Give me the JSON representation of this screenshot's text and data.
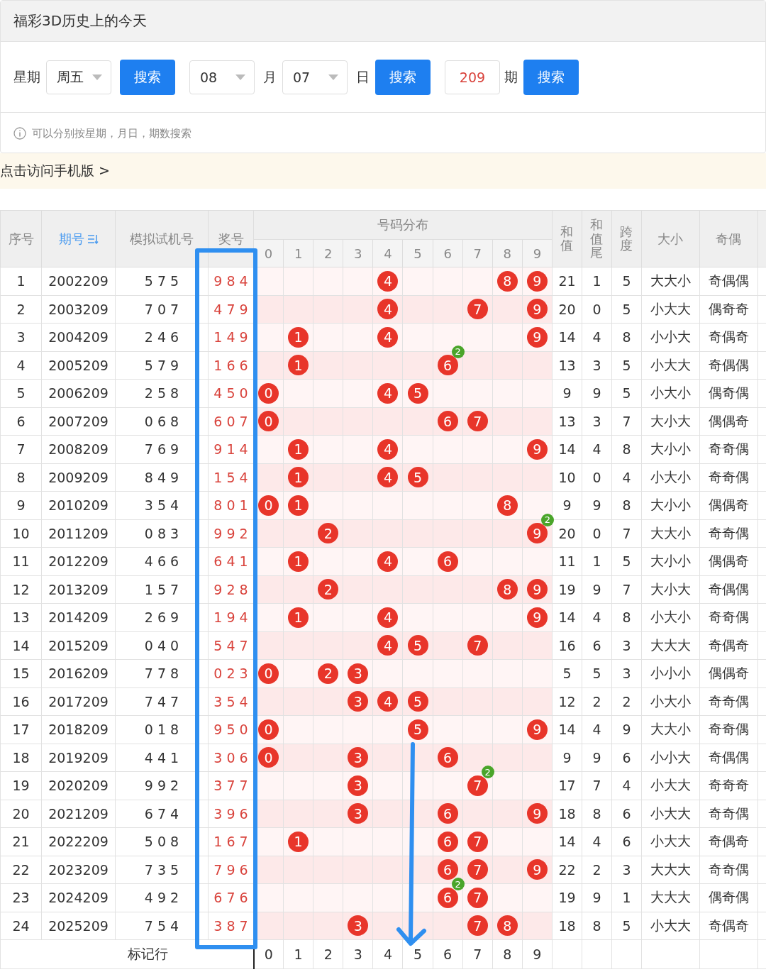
{
  "panel": {
    "title": "福彩3D历史上的今天",
    "controls": [
      {
        "kind": "label",
        "text": "星期"
      },
      {
        "kind": "select",
        "value": "周五"
      },
      {
        "kind": "button",
        "text": "搜索"
      },
      {
        "kind": "select",
        "value": "08"
      },
      {
        "kind": "label",
        "text": "月"
      },
      {
        "kind": "select",
        "value": "07"
      },
      {
        "kind": "label",
        "text": "日"
      },
      {
        "kind": "button",
        "text": "搜索"
      },
      {
        "kind": "input",
        "value": "209"
      },
      {
        "kind": "label",
        "text": "期"
      },
      {
        "kind": "button",
        "text": "搜索"
      }
    ],
    "hint": "可以分别按星期，月日，期数搜索"
  },
  "mobile_link": "点击访问手机版 >",
  "table": {
    "lead_columns": [
      {
        "label": "序号",
        "sortable": false
      },
      {
        "label": "期号",
        "sortable": true
      },
      {
        "label": "模拟试机号",
        "sortable": false
      },
      {
        "label": "奖号",
        "sortable": false
      }
    ],
    "distribution_header": {
      "label": "号码分布",
      "digits": [
        "0",
        "1",
        "2",
        "3",
        "4",
        "5",
        "6",
        "7",
        "8",
        "9"
      ]
    },
    "tail_columns": [
      {
        "label": "和值",
        "stacked": true
      },
      {
        "label": "和值尾",
        "stacked": true
      },
      {
        "label": "跨度",
        "stacked": true
      },
      {
        "label": "大小",
        "stacked": false
      },
      {
        "label": "奇偶",
        "stacked": false
      }
    ],
    "rows": [
      {
        "seq": "1",
        "period": "2002209",
        "trial": "5 7 5",
        "draw": "9 8 4",
        "distribution": [
          {
            "hit": false
          },
          {
            "hit": false
          },
          {
            "hit": false
          },
          {
            "hit": false
          },
          {
            "hit": true,
            "ball": "4"
          },
          {
            "hit": false
          },
          {
            "hit": false
          },
          {
            "hit": false
          },
          {
            "hit": true,
            "ball": "8"
          },
          {
            "hit": true,
            "ball": "9"
          }
        ],
        "sum": "21",
        "sum_tail": "1",
        "span": "5",
        "size": "大大小",
        "parity": "奇偶偶"
      },
      {
        "seq": "2",
        "period": "2003209",
        "trial": "7 0 7",
        "draw": "4 7 9",
        "distribution": [
          {
            "hit": false
          },
          {
            "hit": false
          },
          {
            "hit": false
          },
          {
            "hit": false
          },
          {
            "hit": true,
            "ball": "4"
          },
          {
            "hit": false
          },
          {
            "hit": false
          },
          {
            "hit": true,
            "ball": "7"
          },
          {
            "hit": false
          },
          {
            "hit": true,
            "ball": "9"
          }
        ],
        "sum": "20",
        "sum_tail": "0",
        "span": "5",
        "size": "小大大",
        "parity": "偶奇奇"
      },
      {
        "seq": "3",
        "period": "2004209",
        "trial": "2 4 6",
        "draw": "1 4 9",
        "distribution": [
          {
            "hit": false
          },
          {
            "hit": true,
            "ball": "1"
          },
          {
            "hit": false
          },
          {
            "hit": false
          },
          {
            "hit": true,
            "ball": "4"
          },
          {
            "hit": false
          },
          {
            "hit": false
          },
          {
            "hit": false
          },
          {
            "hit": false
          },
          {
            "hit": true,
            "ball": "9"
          }
        ],
        "sum": "14",
        "sum_tail": "4",
        "span": "8",
        "size": "小小大",
        "parity": "奇偶奇"
      },
      {
        "seq": "4",
        "period": "2005209",
        "trial": "5 7 9",
        "draw": "1 6 6",
        "distribution": [
          {
            "hit": false
          },
          {
            "hit": true,
            "ball": "1"
          },
          {
            "hit": false
          },
          {
            "hit": false
          },
          {
            "hit": false
          },
          {
            "hit": false
          },
          {
            "hit": true,
            "ball": "6",
            "repeat": "2"
          },
          {
            "hit": false
          },
          {
            "hit": false
          },
          {
            "hit": false
          }
        ],
        "sum": "13",
        "sum_tail": "3",
        "span": "5",
        "size": "小大大",
        "parity": "奇偶偶"
      },
      {
        "seq": "5",
        "period": "2006209",
        "trial": "2 5 8",
        "draw": "4 5 0",
        "distribution": [
          {
            "hit": true,
            "ball": "0"
          },
          {
            "hit": false
          },
          {
            "hit": false
          },
          {
            "hit": false
          },
          {
            "hit": true,
            "ball": "4"
          },
          {
            "hit": true,
            "ball": "5"
          },
          {
            "hit": false
          },
          {
            "hit": false
          },
          {
            "hit": false
          },
          {
            "hit": false
          }
        ],
        "sum": "9",
        "sum_tail": "9",
        "span": "5",
        "size": "小大小",
        "parity": "偶奇偶"
      },
      {
        "seq": "6",
        "period": "2007209",
        "trial": "0 6 8",
        "draw": "6 0 7",
        "distribution": [
          {
            "hit": true,
            "ball": "0"
          },
          {
            "hit": false
          },
          {
            "hit": false
          },
          {
            "hit": false
          },
          {
            "hit": false
          },
          {
            "hit": false
          },
          {
            "hit": true,
            "ball": "6"
          },
          {
            "hit": true,
            "ball": "7"
          },
          {
            "hit": false
          },
          {
            "hit": false
          }
        ],
        "sum": "13",
        "sum_tail": "3",
        "span": "7",
        "size": "大小大",
        "parity": "偶偶奇"
      },
      {
        "seq": "7",
        "period": "2008209",
        "trial": "7 6 9",
        "draw": "9 1 4",
        "distribution": [
          {
            "hit": false
          },
          {
            "hit": true,
            "ball": "1"
          },
          {
            "hit": false
          },
          {
            "hit": false
          },
          {
            "hit": true,
            "ball": "4"
          },
          {
            "hit": false
          },
          {
            "hit": false
          },
          {
            "hit": false
          },
          {
            "hit": false
          },
          {
            "hit": true,
            "ball": "9"
          }
        ],
        "sum": "14",
        "sum_tail": "4",
        "span": "8",
        "size": "大小小",
        "parity": "奇奇偶"
      },
      {
        "seq": "8",
        "period": "2009209",
        "trial": "8 4 9",
        "draw": "1 5 4",
        "distribution": [
          {
            "hit": false
          },
          {
            "hit": true,
            "ball": "1"
          },
          {
            "hit": false
          },
          {
            "hit": false
          },
          {
            "hit": true,
            "ball": "4"
          },
          {
            "hit": true,
            "ball": "5"
          },
          {
            "hit": false
          },
          {
            "hit": false
          },
          {
            "hit": false
          },
          {
            "hit": false
          }
        ],
        "sum": "10",
        "sum_tail": "0",
        "span": "4",
        "size": "小大小",
        "parity": "奇奇偶"
      },
      {
        "seq": "9",
        "period": "2010209",
        "trial": "3 5 4",
        "draw": "8 0 1",
        "distribution": [
          {
            "hit": true,
            "ball": "0"
          },
          {
            "hit": true,
            "ball": "1"
          },
          {
            "hit": false
          },
          {
            "hit": false
          },
          {
            "hit": false
          },
          {
            "hit": false
          },
          {
            "hit": false
          },
          {
            "hit": false
          },
          {
            "hit": true,
            "ball": "8"
          },
          {
            "hit": false
          }
        ],
        "sum": "9",
        "sum_tail": "9",
        "span": "8",
        "size": "大小小",
        "parity": "偶偶奇"
      },
      {
        "seq": "10",
        "period": "2011209",
        "trial": "0 8 3",
        "draw": "9 9 2",
        "distribution": [
          {
            "hit": false
          },
          {
            "hit": false
          },
          {
            "hit": true,
            "ball": "2"
          },
          {
            "hit": false
          },
          {
            "hit": false
          },
          {
            "hit": false
          },
          {
            "hit": false
          },
          {
            "hit": false
          },
          {
            "hit": false
          },
          {
            "hit": true,
            "ball": "9",
            "repeat": "2"
          }
        ],
        "sum": "20",
        "sum_tail": "0",
        "span": "7",
        "size": "大大小",
        "parity": "奇奇偶"
      },
      {
        "seq": "11",
        "period": "2012209",
        "trial": "4 6 6",
        "draw": "6 4 1",
        "distribution": [
          {
            "hit": false
          },
          {
            "hit": true,
            "ball": "1"
          },
          {
            "hit": false
          },
          {
            "hit": false
          },
          {
            "hit": true,
            "ball": "4"
          },
          {
            "hit": false
          },
          {
            "hit": true,
            "ball": "6"
          },
          {
            "hit": false
          },
          {
            "hit": false
          },
          {
            "hit": false
          }
        ],
        "sum": "11",
        "sum_tail": "1",
        "span": "5",
        "size": "大小小",
        "parity": "偶偶奇"
      },
      {
        "seq": "12",
        "period": "2013209",
        "trial": "1 5 7",
        "draw": "9 2 8",
        "distribution": [
          {
            "hit": false
          },
          {
            "hit": false
          },
          {
            "hit": true,
            "ball": "2"
          },
          {
            "hit": false
          },
          {
            "hit": false
          },
          {
            "hit": false
          },
          {
            "hit": false
          },
          {
            "hit": false
          },
          {
            "hit": true,
            "ball": "8"
          },
          {
            "hit": true,
            "ball": "9"
          }
        ],
        "sum": "19",
        "sum_tail": "9",
        "span": "7",
        "size": "大小大",
        "parity": "奇偶偶"
      },
      {
        "seq": "13",
        "period": "2014209",
        "trial": "2 6 9",
        "draw": "1 9 4",
        "distribution": [
          {
            "hit": false
          },
          {
            "hit": true,
            "ball": "1"
          },
          {
            "hit": false
          },
          {
            "hit": false
          },
          {
            "hit": true,
            "ball": "4"
          },
          {
            "hit": false
          },
          {
            "hit": false
          },
          {
            "hit": false
          },
          {
            "hit": false
          },
          {
            "hit": true,
            "ball": "9"
          }
        ],
        "sum": "14",
        "sum_tail": "4",
        "span": "8",
        "size": "小大小",
        "parity": "奇奇偶"
      },
      {
        "seq": "14",
        "period": "2015209",
        "trial": "0 4 0",
        "draw": "5 4 7",
        "distribution": [
          {
            "hit": false
          },
          {
            "hit": false
          },
          {
            "hit": false
          },
          {
            "hit": false
          },
          {
            "hit": true,
            "ball": "4"
          },
          {
            "hit": true,
            "ball": "5"
          },
          {
            "hit": false
          },
          {
            "hit": true,
            "ball": "7"
          },
          {
            "hit": false
          },
          {
            "hit": false
          }
        ],
        "sum": "16",
        "sum_tail": "6",
        "span": "3",
        "size": "大大大",
        "parity": "奇偶奇"
      },
      {
        "seq": "15",
        "period": "2016209",
        "trial": "7 7 8",
        "draw": "0 2 3",
        "distribution": [
          {
            "hit": true,
            "ball": "0"
          },
          {
            "hit": false
          },
          {
            "hit": true,
            "ball": "2"
          },
          {
            "hit": true,
            "ball": "3"
          },
          {
            "hit": false
          },
          {
            "hit": false
          },
          {
            "hit": false
          },
          {
            "hit": false
          },
          {
            "hit": false
          },
          {
            "hit": false
          }
        ],
        "sum": "5",
        "sum_tail": "5",
        "span": "3",
        "size": "小小小",
        "parity": "偶偶奇"
      },
      {
        "seq": "16",
        "period": "2017209",
        "trial": "7 4 7",
        "draw": "3 5 4",
        "distribution": [
          {
            "hit": false
          },
          {
            "hit": false
          },
          {
            "hit": false
          },
          {
            "hit": true,
            "ball": "3"
          },
          {
            "hit": true,
            "ball": "4"
          },
          {
            "hit": true,
            "ball": "5"
          },
          {
            "hit": false
          },
          {
            "hit": false
          },
          {
            "hit": false
          },
          {
            "hit": false
          }
        ],
        "sum": "12",
        "sum_tail": "2",
        "span": "2",
        "size": "小大小",
        "parity": "奇奇偶"
      },
      {
        "seq": "17",
        "period": "2018209",
        "trial": "0 1 8",
        "draw": "9 5 0",
        "distribution": [
          {
            "hit": true,
            "ball": "0"
          },
          {
            "hit": false
          },
          {
            "hit": false
          },
          {
            "hit": false
          },
          {
            "hit": false
          },
          {
            "hit": true,
            "ball": "5"
          },
          {
            "hit": false
          },
          {
            "hit": false
          },
          {
            "hit": false
          },
          {
            "hit": true,
            "ball": "9"
          }
        ],
        "sum": "14",
        "sum_tail": "4",
        "span": "9",
        "size": "大大小",
        "parity": "奇奇偶"
      },
      {
        "seq": "18",
        "period": "2019209",
        "trial": "4 4 1",
        "draw": "3 0 6",
        "distribution": [
          {
            "hit": true,
            "ball": "0"
          },
          {
            "hit": false
          },
          {
            "hit": false
          },
          {
            "hit": true,
            "ball": "3"
          },
          {
            "hit": false
          },
          {
            "hit": false
          },
          {
            "hit": true,
            "ball": "6"
          },
          {
            "hit": false
          },
          {
            "hit": false
          },
          {
            "hit": false
          }
        ],
        "sum": "9",
        "sum_tail": "9",
        "span": "6",
        "size": "小小大",
        "parity": "奇偶偶"
      },
      {
        "seq": "19",
        "period": "2020209",
        "trial": "9 9 2",
        "draw": "3 7 7",
        "distribution": [
          {
            "hit": false
          },
          {
            "hit": false
          },
          {
            "hit": false
          },
          {
            "hit": true,
            "ball": "3"
          },
          {
            "hit": false
          },
          {
            "hit": false
          },
          {
            "hit": false
          },
          {
            "hit": true,
            "ball": "7",
            "repeat": "2"
          },
          {
            "hit": false
          },
          {
            "hit": false
          }
        ],
        "sum": "17",
        "sum_tail": "7",
        "span": "4",
        "size": "小大大",
        "parity": "奇奇奇"
      },
      {
        "seq": "20",
        "period": "2021209",
        "trial": "6 7 4",
        "draw": "3 9 6",
        "distribution": [
          {
            "hit": false
          },
          {
            "hit": false
          },
          {
            "hit": false
          },
          {
            "hit": true,
            "ball": "3"
          },
          {
            "hit": false
          },
          {
            "hit": false
          },
          {
            "hit": true,
            "ball": "6"
          },
          {
            "hit": false
          },
          {
            "hit": false
          },
          {
            "hit": true,
            "ball": "9"
          }
        ],
        "sum": "18",
        "sum_tail": "8",
        "span": "6",
        "size": "小大大",
        "parity": "奇奇偶"
      },
      {
        "seq": "21",
        "period": "2022209",
        "trial": "5 0 8",
        "draw": "1 6 7",
        "distribution": [
          {
            "hit": false
          },
          {
            "hit": true,
            "ball": "1"
          },
          {
            "hit": false
          },
          {
            "hit": false
          },
          {
            "hit": false
          },
          {
            "hit": false
          },
          {
            "hit": true,
            "ball": "6"
          },
          {
            "hit": true,
            "ball": "7"
          },
          {
            "hit": false
          },
          {
            "hit": false
          }
        ],
        "sum": "14",
        "sum_tail": "4",
        "span": "6",
        "size": "小大大",
        "parity": "奇偶奇"
      },
      {
        "seq": "22",
        "period": "2023209",
        "trial": "7 3 5",
        "draw": "7 9 6",
        "distribution": [
          {
            "hit": false
          },
          {
            "hit": false
          },
          {
            "hit": false
          },
          {
            "hit": false
          },
          {
            "hit": false
          },
          {
            "hit": false
          },
          {
            "hit": true,
            "ball": "6"
          },
          {
            "hit": true,
            "ball": "7"
          },
          {
            "hit": false
          },
          {
            "hit": true,
            "ball": "9"
          }
        ],
        "sum": "22",
        "sum_tail": "2",
        "span": "3",
        "size": "大大大",
        "parity": "奇奇偶"
      },
      {
        "seq": "23",
        "period": "2024209",
        "trial": "4 9 2",
        "draw": "6 7 6",
        "distribution": [
          {
            "hit": false
          },
          {
            "hit": false
          },
          {
            "hit": false
          },
          {
            "hit": false
          },
          {
            "hit": false
          },
          {
            "hit": false
          },
          {
            "hit": true,
            "ball": "6",
            "repeat": "2"
          },
          {
            "hit": true,
            "ball": "7"
          },
          {
            "hit": false
          },
          {
            "hit": false
          }
        ],
        "sum": "19",
        "sum_tail": "9",
        "span": "1",
        "size": "大大大",
        "parity": "偶奇偶"
      },
      {
        "seq": "24",
        "period": "2025209",
        "trial": "7 5 4",
        "draw": "3 8 7",
        "distribution": [
          {
            "hit": false
          },
          {
            "hit": false
          },
          {
            "hit": false
          },
          {
            "hit": true,
            "ball": "3"
          },
          {
            "hit": false
          },
          {
            "hit": false
          },
          {
            "hit": false
          },
          {
            "hit": true,
            "ball": "7"
          },
          {
            "hit": true,
            "ball": "8"
          },
          {
            "hit": false
          }
        ],
        "sum": "18",
        "sum_tail": "8",
        "span": "5",
        "size": "小大大",
        "parity": "奇偶奇"
      }
    ],
    "footer": {
      "label": "标记行",
      "digits": [
        "0",
        "1",
        "2",
        "3",
        "4",
        "5",
        "6",
        "7",
        "8",
        "9"
      ]
    }
  }
}
